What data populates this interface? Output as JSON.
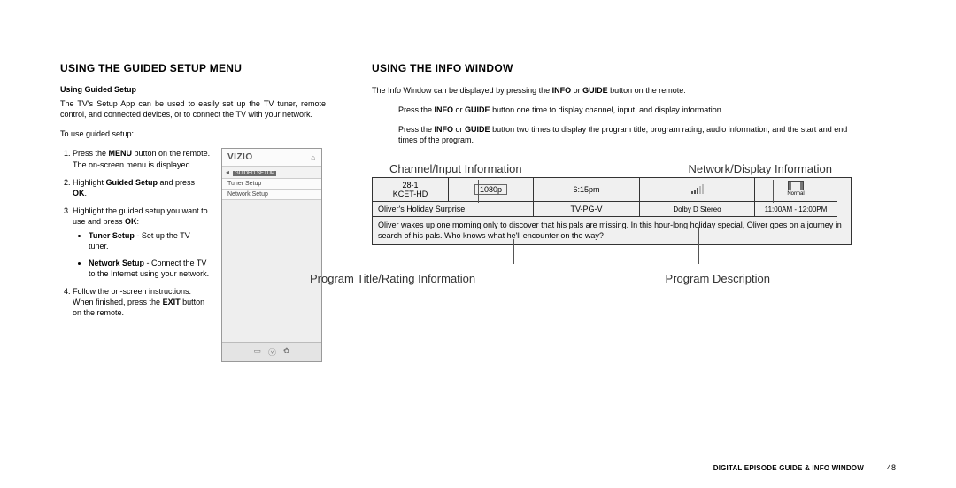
{
  "left": {
    "heading": "USING THE GUIDED SETUP MENU",
    "sub": "Using Guided Setup",
    "intro": "The TV's Setup App can be used to easily set up the TV tuner, remote control, and connected devices, or to connect the TV with your network.",
    "lead": "To use guided setup:",
    "step1a": "Press the ",
    "step1b": "MENU",
    "step1c": " button on the remote. The on-screen menu is displayed.",
    "step2a": "Highlight ",
    "step2b": "Guided Setup",
    "step2c": " and press ",
    "step2d": "OK",
    "step2e": ".",
    "step3a": "Highlight the guided setup you want to use and press ",
    "step3b": "OK",
    "step3c": ":",
    "bullet1a": "Tuner Setup",
    "bullet1b": " - Set up the TV tuner.",
    "bullet2a": "Network Setup",
    "bullet2b": " - Connect the TV to the Internet using your network.",
    "step4a": "Follow the on-screen instructions. When finished, press the ",
    "step4b": "EXIT",
    "step4c": " button on the remote.",
    "menu": {
      "brand": "VIZIO",
      "crumb": "GUIDED SETUP",
      "item1": "Tuner Setup",
      "item2": "Network Setup"
    }
  },
  "right": {
    "heading": "USING THE INFO WINDOW",
    "p1a": "The Info Window can be displayed by pressing the ",
    "p1b": "INFO",
    "p1c": " or ",
    "p1d": "GUIDE",
    "p1e": " button on the remote:",
    "p2a": "Press the ",
    "p2b": "INFO",
    "p2c": " or ",
    "p2d": "GUIDE",
    "p2e": " button one time to display channel, input, and display information.",
    "p3a": "Press the ",
    "p3b": "INFO",
    "p3c": " or ",
    "p3d": "GUIDE",
    "p3e": " button two times to display the program title, program rating, audio information, and the start and end times of the program.",
    "labels": {
      "ch": "Channel/Input Information",
      "net": "Network/Display Information",
      "title": "Program Title/Rating Information",
      "desc": "Program Description"
    },
    "info": {
      "chnum": "28-1",
      "chname": "KCET-HD",
      "res": "1080p",
      "time": "6:15pm",
      "aspect": "Normal",
      "prog": "Oliver's Holiday Surprise",
      "rating": "TV-PG-V",
      "audio": "Dolby D Stereo",
      "span": "11:00AM - 12:00PM",
      "desc": "Oliver wakes up one morning only to discover that his pals are missing. In this hour-long holiday special, Oliver goes on a journey in search of his pals. Who knows what he'll encounter on the way?"
    }
  },
  "footer": {
    "section": "DIGITAL EPISODE GUIDE & INFO WINDOW",
    "page": "48"
  }
}
